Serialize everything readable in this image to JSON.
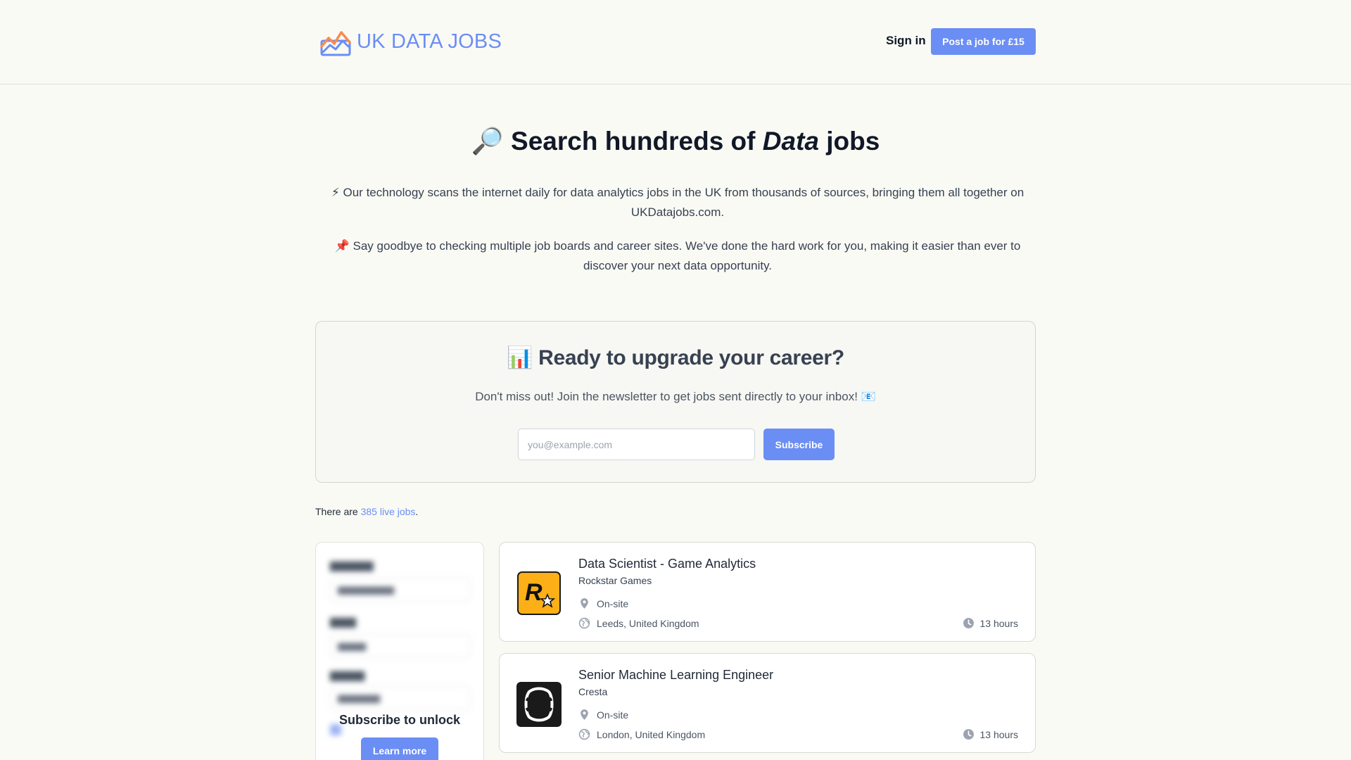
{
  "header": {
    "logo_text": "UK DATA JOBS",
    "signin_label": "Sign in",
    "post_job_label": "Post a job for £15"
  },
  "hero": {
    "title_emoji": "🔎",
    "title_before": "Search hundreds of",
    "title_em": "Data",
    "title_after": "jobs",
    "paragraph1": "⚡ Our technology scans the internet daily for data analytics jobs in the UK from thousands of sources, bringing them all together on UKDatajobs.com.",
    "paragraph2": "📌 Say goodbye to checking multiple job boards and career sites. We've done the hard work for you, making it easier than ever to discover your next data opportunity."
  },
  "newsletter": {
    "title": "📊 Ready to upgrade your career?",
    "subtitle": "Don't miss out! Join the newsletter to get jobs sent directly to your inbox! 📧",
    "email_placeholder": "you@example.com",
    "subscribe_label": "Subscribe"
  },
  "count": {
    "prefix": "There are",
    "link_text": "385 live jobs",
    "suffix": "."
  },
  "filters": {
    "unlock_title": "Subscribe to unlock",
    "learn_more_label": "Learn more"
  },
  "jobs": [
    {
      "title": "Data Scientist - Game Analytics",
      "company": "Rockstar Games",
      "work_type": "On-site",
      "location": "Leeds, United Kingdom",
      "posted": "13 hours",
      "logo_icon": "rockstar-logo"
    },
    {
      "title": "Senior Machine Learning Engineer",
      "company": "Cresta",
      "work_type": "On-site",
      "location": "London, United Kingdom",
      "posted": "13 hours",
      "logo_icon": "cresta-logo"
    }
  ],
  "colors": {
    "accent": "#6b8ef5",
    "background": "#fafaf5",
    "rockstar_yellow": "#fcaf17"
  }
}
